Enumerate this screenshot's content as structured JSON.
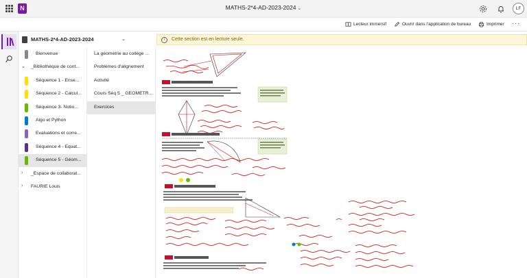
{
  "titlebar": {
    "document_title": "MATHS-2*4-AD-2023-2024",
    "avatar_initials": "LF"
  },
  "commandbar": {
    "immersive_reader": "Lecteur immersif",
    "open_desktop": "Ouvrir dans l'application de bureau",
    "print": "Imprimer",
    "more": "···"
  },
  "notebook": {
    "name": "MATHS-2*4-AD-2023-2024"
  },
  "sections": [
    {
      "label": "Bienvenue",
      "color": "#8a8886",
      "type": "section",
      "selected": false
    },
    {
      "label": "_Bibliothèque de cont...",
      "color": "",
      "type": "group",
      "expand": "⌄",
      "selected": false
    },
    {
      "label": "Séquence 1 - Ense...",
      "color": "#fce100",
      "type": "section",
      "selected": false
    },
    {
      "label": "Séquence 2 - Calcul...",
      "color": "#fce100",
      "type": "section",
      "selected": false
    },
    {
      "label": "Séquence 3- Notio...",
      "color": "#6bb700",
      "type": "section",
      "selected": false
    },
    {
      "label": "Algo et Python",
      "color": "#0078d4",
      "type": "section",
      "selected": false
    },
    {
      "label": "Evaluations et corre...",
      "color": "#8764b8",
      "type": "section",
      "selected": false
    },
    {
      "label": "Séquence 4 - Equat...",
      "color": "#5c2e91",
      "type": "section",
      "selected": false
    },
    {
      "label": "Séquence 5 - Géom...",
      "color": "#6bb700",
      "type": "section",
      "selected": true
    },
    {
      "label": "_Espace de collaborat...",
      "color": "",
      "type": "group",
      "expand": "›",
      "selected": false
    },
    {
      "label": "FAURIE Louis",
      "color": "",
      "type": "group",
      "expand": "›",
      "selected": false
    }
  ],
  "pages": [
    {
      "label": "La géométrie au collège ...",
      "selected": false
    },
    {
      "label": "Problèmes d'alignement",
      "selected": false
    },
    {
      "label": "Activité",
      "selected": false
    },
    {
      "label": "Cours Séq 5 _ GEOMETR...",
      "selected": false
    },
    {
      "label": "Exercices",
      "selected": true
    }
  ],
  "infobar": {
    "message": "Cette section est en lecture seule."
  },
  "icons": {
    "apps": "waffle-icon",
    "app_logo": "onenote-icon",
    "settings": "gear-icon",
    "notifications": "bell-icon",
    "immersive": "immersive-reader-icon",
    "edit": "pencil-icon",
    "print": "printer-icon",
    "notebooks": "notebooks-icon",
    "search": "search-icon",
    "info": "info-icon"
  },
  "colors": {
    "accent": "#7719aa",
    "ink_red": "#d40000",
    "infobar_bg": "#fdf6d8"
  }
}
